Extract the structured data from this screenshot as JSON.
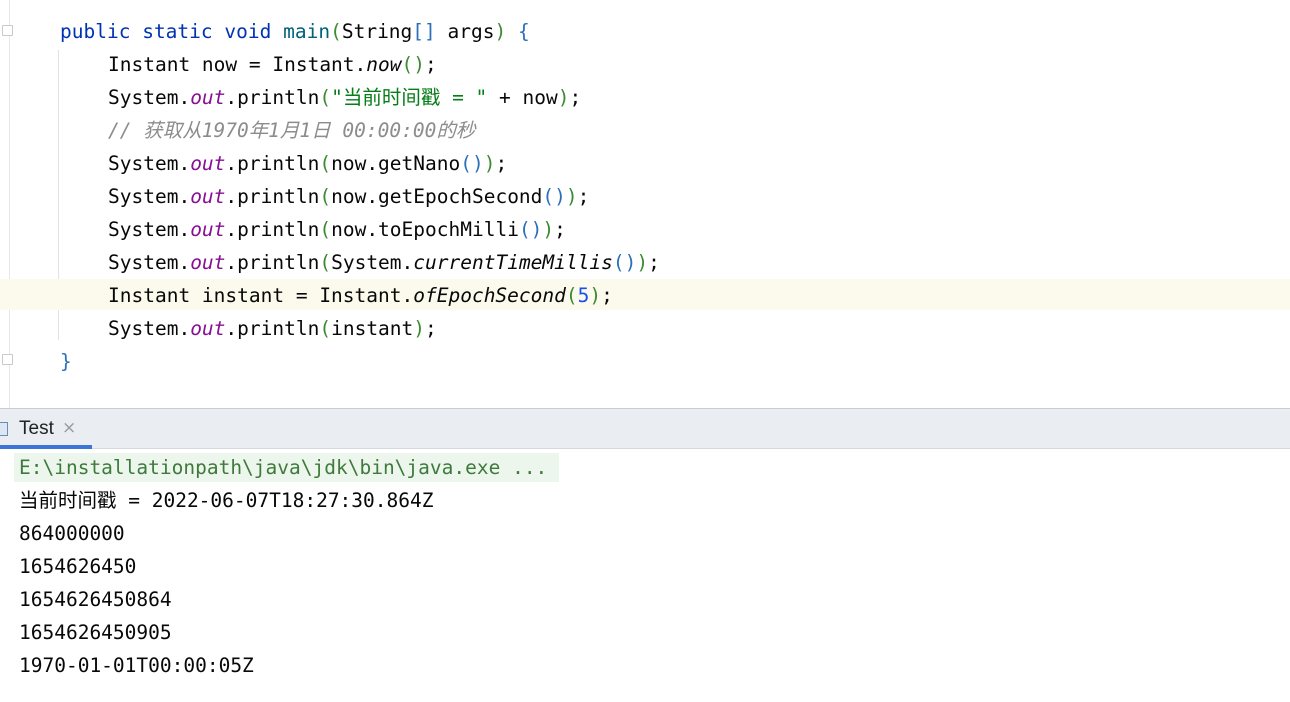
{
  "editor": {
    "lines": [
      {
        "parts": [
          "public",
          " ",
          "static",
          " ",
          "void",
          " ",
          "main",
          "(",
          "String",
          "[]",
          " args",
          ")",
          " ",
          "{"
        ]
      },
      {
        "parts": [
          "Instant now = Instant.",
          "now",
          "()",
          ";"
        ]
      },
      {
        "parts": [
          "System.",
          "out",
          ".println",
          "(",
          "\"当前时间戳 = \"",
          " + now",
          ")",
          ";"
        ]
      },
      {
        "parts": [
          "// 获取从1970年1月1日 00:00:00的秒"
        ]
      },
      {
        "parts": [
          "System.",
          "out",
          ".println",
          "(",
          "now.getNano",
          "()",
          ")",
          ";"
        ]
      },
      {
        "parts": [
          "System.",
          "out",
          ".println",
          "(",
          "now.getEpochSecond",
          "()",
          ")",
          ";"
        ]
      },
      {
        "parts": [
          "System.",
          "out",
          ".println",
          "(",
          "now.toEpochMilli",
          "()",
          ")",
          ";"
        ]
      },
      {
        "parts": [
          "System.",
          "out",
          ".println",
          "(",
          "System.",
          "currentTimeMillis",
          "()",
          ")",
          ";"
        ]
      },
      {
        "parts": [
          "Instant instant = Instant.",
          "ofEpochSecond",
          "(",
          "5",
          ")",
          ";"
        ]
      },
      {
        "parts": [
          "System.",
          "out",
          ".println",
          "(",
          "instant",
          ")",
          ";"
        ]
      },
      {
        "parts": [
          "}"
        ]
      }
    ]
  },
  "run_panel": {
    "tab_label": "Test",
    "tab_close": "×",
    "output": [
      "E:\\installationpath\\java\\jdk\\bin\\java.exe ...",
      "当前时间戳 = 2022-06-07T18:27:30.864Z",
      "864000000",
      "1654626450",
      "1654626450864",
      "1654626450905",
      "1970-01-01T00:00:05Z"
    ]
  },
  "colors": {
    "keyword": "#0033b3",
    "method": "#00627a",
    "string": "#067d17",
    "static_field": "#871094",
    "number": "#1750eb",
    "comment": "#8c8c8c",
    "caret_row": "#fcfaed",
    "tab_accent": "#3d75d6"
  }
}
